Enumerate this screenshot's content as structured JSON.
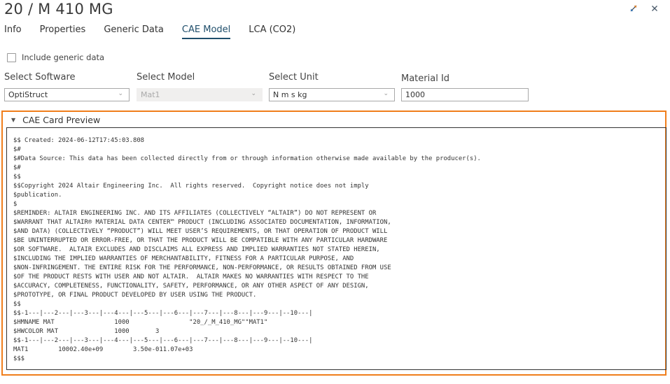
{
  "window": {
    "title": "20 / M 410 MG",
    "controls": {
      "expand_icon": "expand-arrows-icon",
      "close_icon": "close-icon"
    }
  },
  "tabs": [
    {
      "label": "Info",
      "active": false
    },
    {
      "label": "Properties",
      "active": false
    },
    {
      "label": "Generic Data",
      "active": false
    },
    {
      "label": "CAE Model",
      "active": true
    },
    {
      "label": "LCA (CO2)",
      "active": false
    }
  ],
  "options": {
    "include_generic_label": "Include generic data",
    "include_generic_checked": false
  },
  "form": {
    "software": {
      "label": "Select Software",
      "value": "OptiStruct"
    },
    "model": {
      "label": "Select Model",
      "value": "Mat1",
      "disabled": true
    },
    "unit": {
      "label": "Select Unit",
      "value": "N m s kg"
    },
    "material_id": {
      "label": "Material Id",
      "value": "1000"
    }
  },
  "preview": {
    "title": "CAE Card Preview",
    "expanded": true,
    "accent_color": "#f07e1b",
    "lines": [
      "$$ Created: 2024-06-12T17:45:03.808",
      "$#",
      "$#Data Source: This data has been collected directly from or through information otherwise made available by the producer(s).",
      "$#",
      "$$",
      "$$Copyright 2024 Altair Engineering Inc.  All rights reserved.  Copyright notice does not imply",
      "$publication.",
      "$",
      "$REMINDER: ALTAIR ENGINEERING INC. AND ITS AFFILIATES (COLLECTIVELY “ALTAIR”) DO NOT REPRESENT OR",
      "$WARRANT THAT ALTAIR® MATERIAL DATA CENTER™ PRODUCT (INCLUDING ASSOCIATED DOCUMENTATION, INFORMATION,",
      "$AND DATA) (COLLECTIVELY “PRODUCT”) WILL MEET USER’S REQUIREMENTS, OR THAT OPERATION OF PRODUCT WILL",
      "$BE UNINTERRUPTED OR ERROR-FREE, OR THAT THE PRODUCT WILL BE COMPATIBLE WITH ANY PARTICULAR HARDWARE",
      "$OR SOFTWARE.  ALTAIR EXCLUDES AND DISCLAIMS ALL EXPRESS AND IMPLIED WARRANTIES NOT STATED HEREIN,",
      "$INCLUDING THE IMPLIED WARRANTIES OF MERCHANTABILITY, FITNESS FOR A PARTICULAR PURPOSE, AND",
      "$NON-INFRINGEMENT. THE ENTIRE RISK FOR THE PERFORMANCE, NON-PERFORMANCE, OR RESULTS OBTAINED FROM USE",
      "$OF THE PRODUCT RESTS WITH USER AND NOT ALTAIR.  ALTAIR MAKES NO WARRANTIES WITH RESPECT TO THE",
      "$ACCURACY, COMPLETENESS, FUNCTIONALITY, SAFETY, PERFORMANCE, OR ANY OTHER ASPECT OF ANY DESIGN,",
      "$PROTOTYPE, OR FINAL PRODUCT DEVELOPED BY USER USING THE PRODUCT.",
      "$$",
      "$$-1---|---2---|---3---|---4---|---5---|---6---|---7---|---8---|---9---|--10---|",
      "$HMNAME MAT                1000                \"20_/_M_410_MG\"\"MAT1\"",
      "$HWCOLOR MAT               1000       3",
      "$$-1---|---2---|---3---|---4---|---5---|---6---|---7---|---8---|---9---|--10---|",
      "MAT1        10002.40e+09        3.50e-011.07e+03",
      "$$$"
    ]
  }
}
